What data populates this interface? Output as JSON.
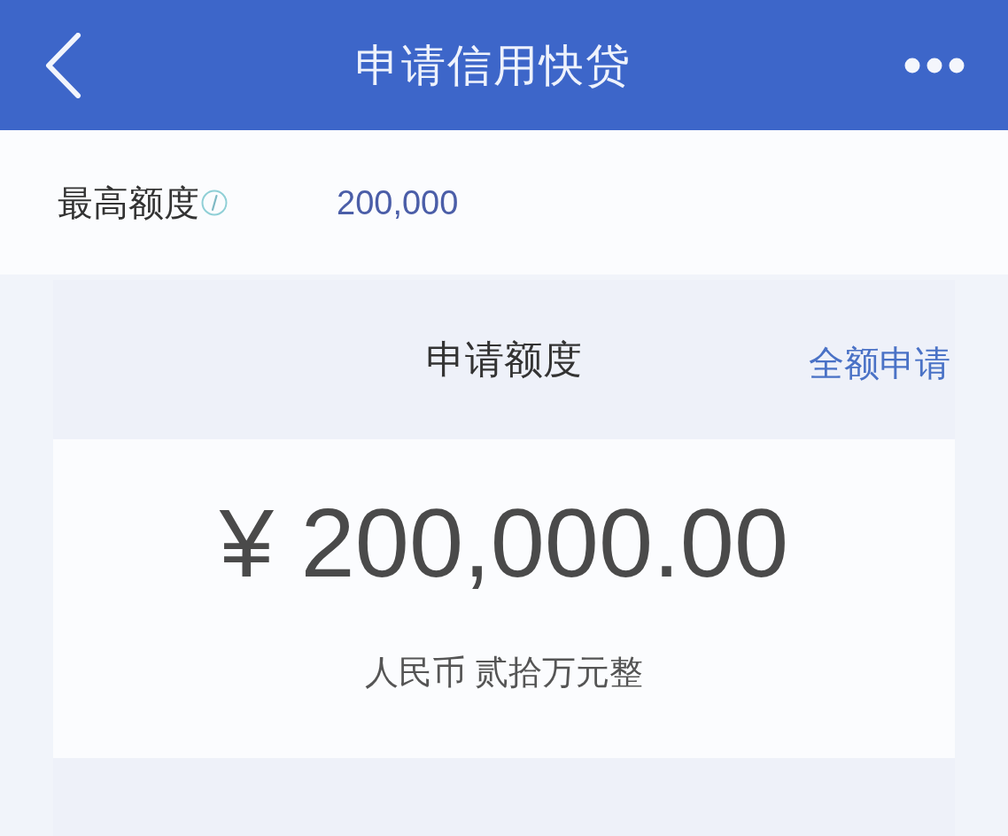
{
  "header": {
    "title": "申请信用快贷"
  },
  "max_limit": {
    "label": "最高额度",
    "value": "200,000"
  },
  "apply_amount": {
    "title": "申请额度",
    "full_amount_link": "全额申请",
    "amount": "¥ 200,000.00",
    "amount_in_words": "人民币 贰拾万元整"
  }
}
